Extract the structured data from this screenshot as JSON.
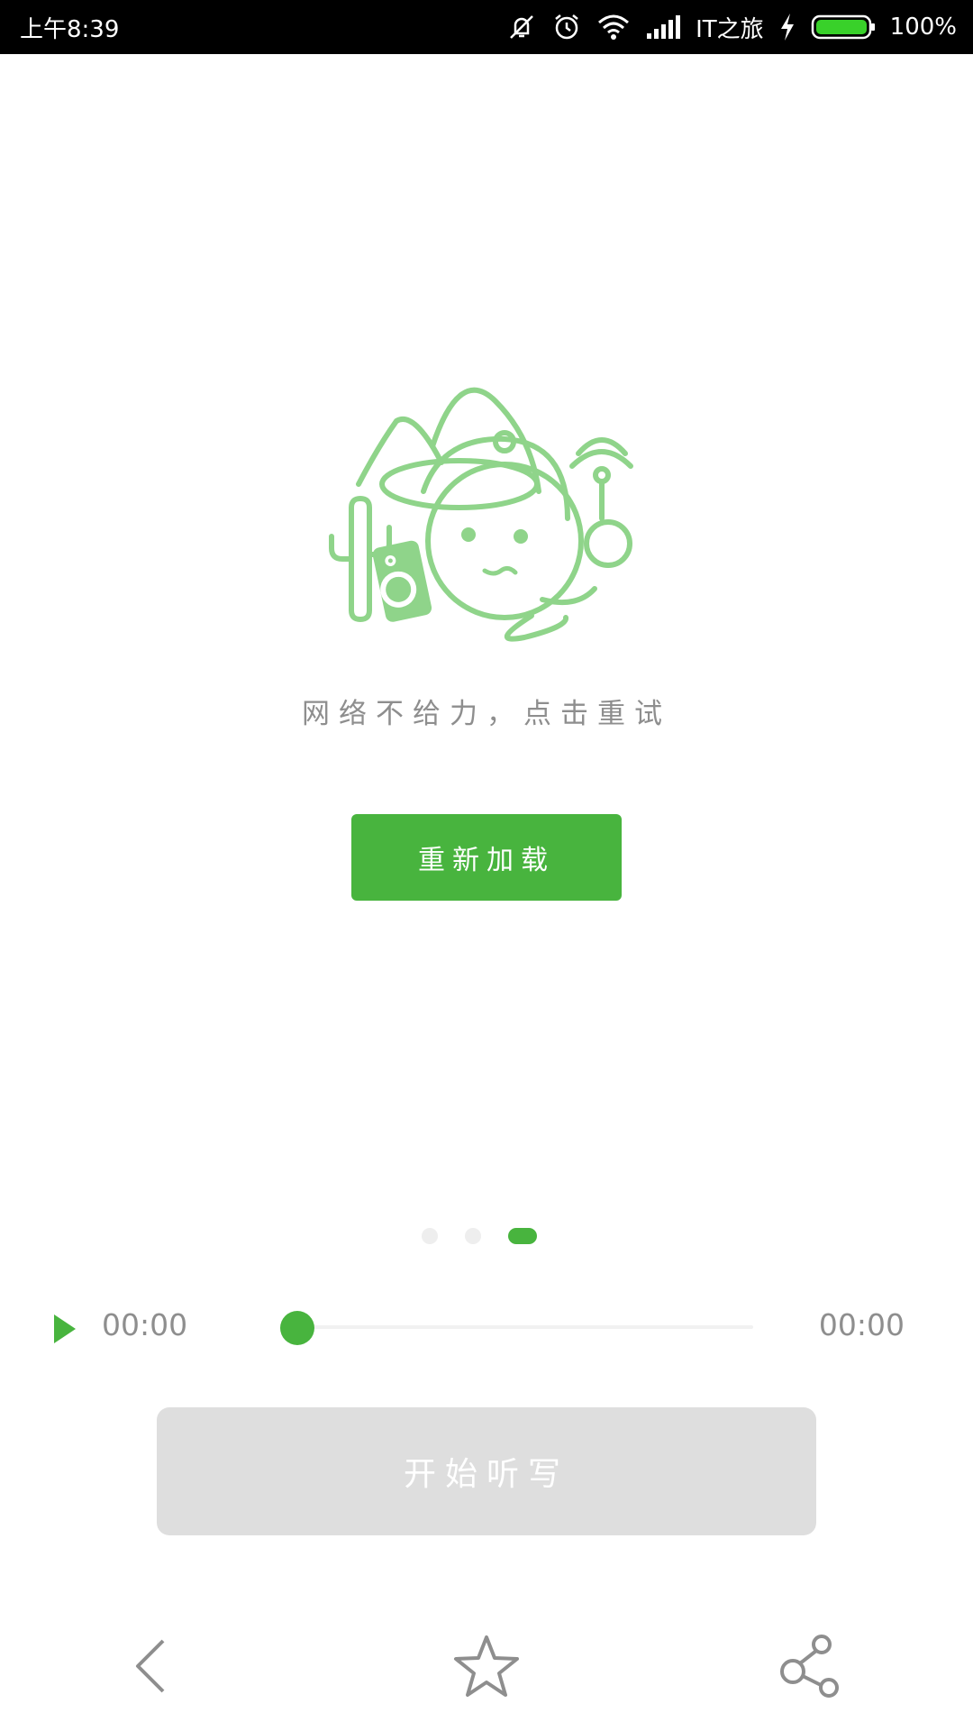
{
  "status_bar": {
    "time": "上午8:39",
    "carrier": "IT之旅",
    "battery": "100%",
    "icons": [
      "mute-icon",
      "alarm-icon",
      "wifi-icon",
      "signal-icon",
      "charging-icon",
      "battery-icon"
    ]
  },
  "main": {
    "error_message": "网络不给力，点击重试",
    "reload_label": "重新加载"
  },
  "pager": {
    "count": 3,
    "active_index": 2
  },
  "player": {
    "current_time": "00:00",
    "total_time": "00:00",
    "progress": 0
  },
  "dictation": {
    "label": "开始听写"
  },
  "bottom_nav": {
    "icons": [
      "back-icon",
      "favorite-star-icon",
      "share-icon"
    ]
  },
  "colors": {
    "accent": "#48b43e",
    "illustration": "#8fd48a",
    "text_gray": "#8e8e8e",
    "disabled_button": "#dedede"
  }
}
